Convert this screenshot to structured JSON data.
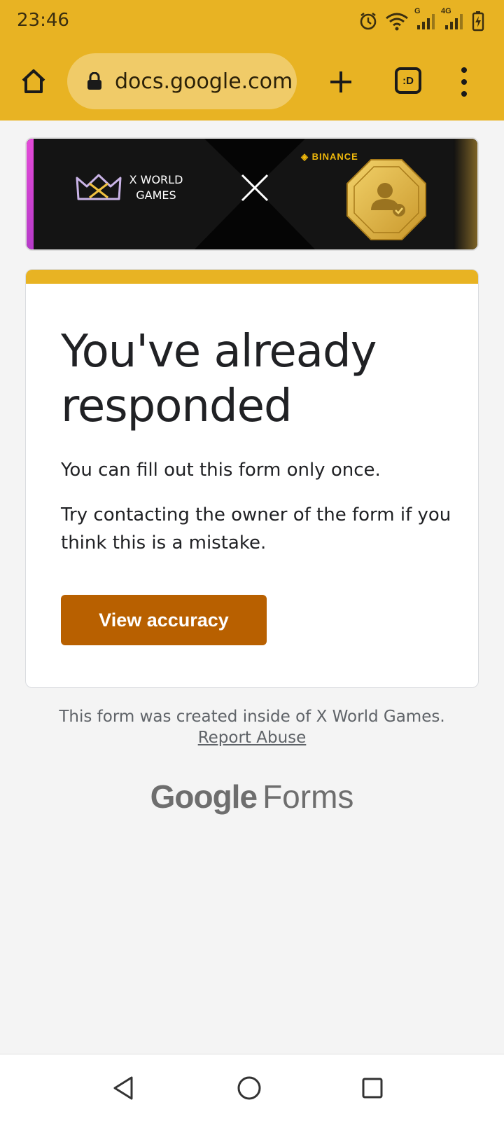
{
  "status_bar": {
    "time": "23:46",
    "icons": [
      "alarm-icon",
      "wifi-icon",
      "signal-g-icon",
      "signal-4g-icon",
      "battery-charging-icon"
    ],
    "network_labels": [
      "G",
      "4G"
    ]
  },
  "browser": {
    "url": "docs.google.com",
    "tab_switcher_label": ":D",
    "toolbar_color": "#e8b323"
  },
  "banner": {
    "left_brand": "X WORLD GAMES",
    "left_brand_line1": "X WORLD",
    "left_brand_line2": "GAMES",
    "right_brand": "BINANCE"
  },
  "card": {
    "title": "You've already responded",
    "message": "You can fill out this form only once.",
    "hint": "Try contacting the owner of the form if you think this is a mistake.",
    "button_label": "View accuracy",
    "accent_color": "#e8b323",
    "button_color": "#b86000"
  },
  "footer": {
    "created_inside": "This form was created inside of X World Games.",
    "report_abuse": "Report Abuse",
    "logo_google": "Google",
    "logo_forms": "Forms"
  },
  "nav_bar": {
    "buttons": [
      "back-icon",
      "home-icon",
      "recents-icon"
    ]
  }
}
